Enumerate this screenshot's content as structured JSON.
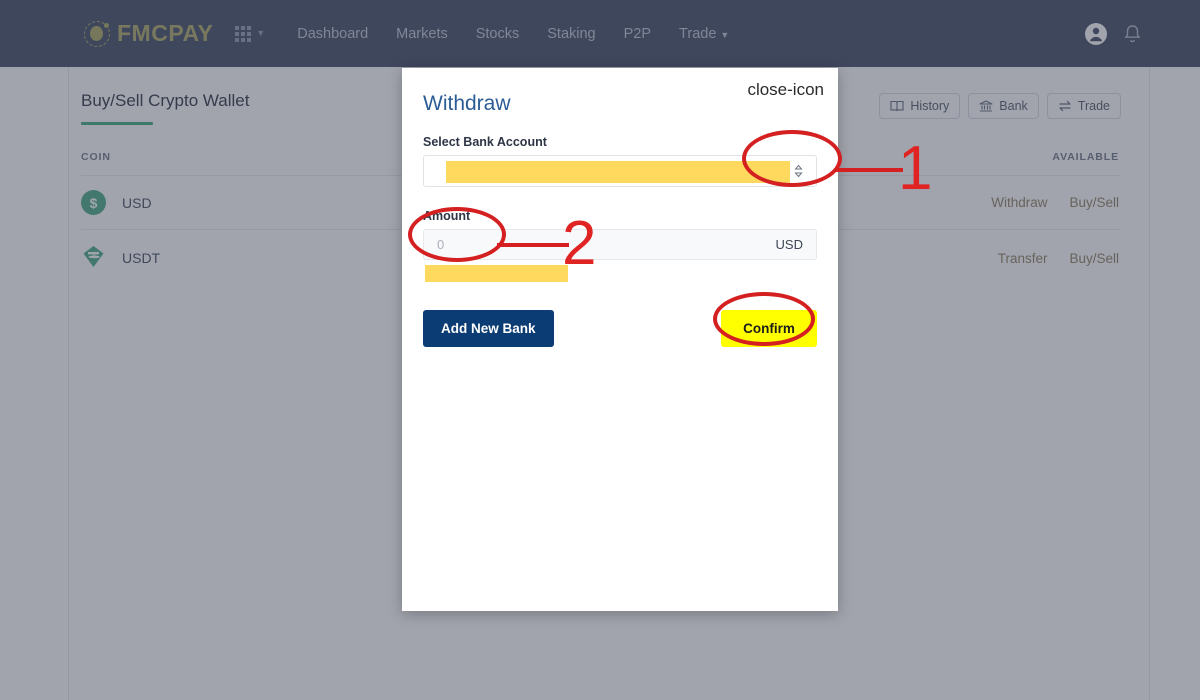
{
  "nav": {
    "brand": "FMCPAY",
    "apps_icon": "apps-grid-icon",
    "links": [
      {
        "label": "Dashboard",
        "has_caret": false
      },
      {
        "label": "Markets",
        "has_caret": false
      },
      {
        "label": "Stocks",
        "has_caret": false
      },
      {
        "label": "Staking",
        "has_caret": false
      },
      {
        "label": "P2P",
        "has_caret": false
      },
      {
        "label": "Trade",
        "has_caret": true
      }
    ],
    "account_icon": "user-account-icon",
    "notification_icon": "bell-icon"
  },
  "page": {
    "title": "Buy/Sell Crypto Wallet",
    "head_buttons": [
      {
        "label": "History",
        "icon": "book-icon"
      },
      {
        "label": "Bank",
        "icon": "bank-icon"
      },
      {
        "label": "Trade",
        "icon": "swap-arrows-icon"
      }
    ],
    "table": {
      "columns": [
        "COIN",
        "AVAILABLE"
      ],
      "rows": [
        {
          "coin": "USD",
          "icon": "usd-dollar-circle-icon",
          "available": "",
          "actions": [
            "Withdraw",
            "Buy/Sell"
          ]
        },
        {
          "coin": "USDT",
          "icon": "tether-icon",
          "available": "",
          "actions": [
            "Transfer",
            "Buy/Sell"
          ]
        }
      ]
    }
  },
  "modal": {
    "title": "Withdraw",
    "close_icon": "close-icon",
    "select_label": "Select Bank Account",
    "select_value": "",
    "select_icon": "select-updown-arrows-icon",
    "amount_label": "Amount",
    "amount_value": "",
    "amount_placeholder": "0",
    "amount_unit": "USD",
    "add_bank_label": "Add New Bank",
    "confirm_label": "Confirm"
  },
  "annotations": {
    "markers": [
      {
        "number": "1",
        "target": "select-bank-account-dropdown"
      },
      {
        "number": "2",
        "target": "amount-input"
      }
    ],
    "confirm_highlight": "Confirm"
  },
  "colors": {
    "nav_bg": "#4e566d",
    "brand": "#b5b072",
    "accent_green": "#4caf85",
    "modal_title": "#2b5c96",
    "add_bank_bg": "#0c3c74",
    "confirm_bg": "#ffff00",
    "annotation_red": "#d42020",
    "redaction_yellow": "#ffd95e"
  }
}
